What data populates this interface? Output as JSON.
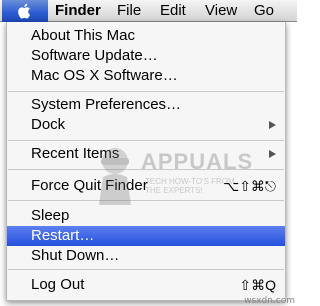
{
  "menubar": {
    "items": [
      "Finder",
      "File",
      "Edit",
      "View",
      "Go"
    ]
  },
  "apple_menu": {
    "items": [
      {
        "label": "About This Mac",
        "shortcut": "",
        "submenu": false
      },
      {
        "label": "Software Update…",
        "shortcut": "",
        "submenu": false
      },
      {
        "label": "Mac OS X Software…",
        "shortcut": "",
        "submenu": false
      },
      {
        "label": "System Preferences…",
        "shortcut": "",
        "submenu": false
      },
      {
        "label": "Dock",
        "shortcut": "",
        "submenu": true
      },
      {
        "label": "Recent Items",
        "shortcut": "",
        "submenu": true
      },
      {
        "label": "Force Quit Finder",
        "shortcut": "⌥⇧⌘⎋",
        "submenu": false
      },
      {
        "label": "Sleep",
        "shortcut": "",
        "submenu": false
      },
      {
        "label": "Restart…",
        "shortcut": "",
        "submenu": false,
        "selected": true
      },
      {
        "label": "Shut Down…",
        "shortcut": "",
        "submenu": false
      },
      {
        "label": "Log Out",
        "shortcut": "⇧⌘Q",
        "submenu": false
      }
    ]
  },
  "watermark": {
    "title": "APPUALS",
    "subtitle_line1": "TECH HOW-TO'S FROM",
    "subtitle_line2": "THE EXPERTS!"
  },
  "credit": "wsxdn.com",
  "colors": {
    "selection": "#2f5fe0",
    "apple_tab": "#2b5bd1",
    "menu_bg": "#f6f6f6"
  },
  "icons": {
    "apple": "apple-logo-icon",
    "submenu": "submenu-arrow-icon"
  }
}
